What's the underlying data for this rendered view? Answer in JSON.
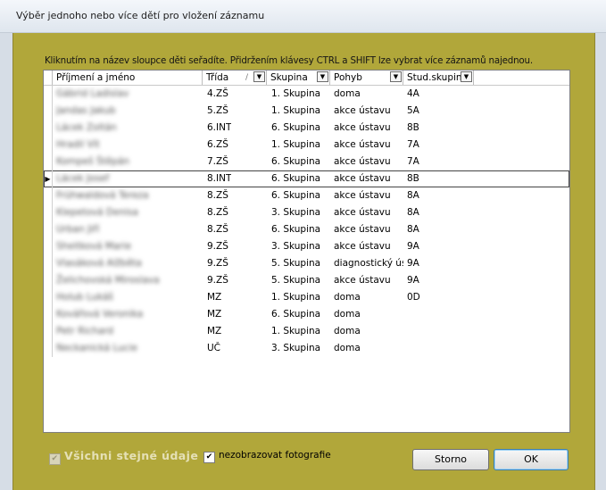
{
  "window": {
    "title": "Výběr jednoho nebo více dětí pro vložení záznamu"
  },
  "hint": "Kliknutím na název sloupce děti seřadíte. Přidržením klávesy CTRL a SHIFT lze vybrat více záznamů najednou.",
  "columns": {
    "name": "Příjmení a jméno",
    "trida": "Třída",
    "sort_indicator": "/",
    "skupina": "Skupina",
    "pohyb": "Pohyb",
    "stud": "Stud.skupina",
    "dropdown_glyph": "▼"
  },
  "current_row_marker": "▶",
  "rows": [
    {
      "name": "Gábrid Ladislav",
      "trida": "4.ZŠ",
      "skupina": "1. Skupina",
      "pohyb": "doma",
      "stud": "4A"
    },
    {
      "name": "Jandas Jakub",
      "trida": "5.ZŠ",
      "skupina": "1. Skupina",
      "pohyb": "akce ústavu",
      "stud": "5A"
    },
    {
      "name": "Lácek Zoltán",
      "trida": "6.INT",
      "skupina": "6. Skupina",
      "pohyb": "akce ústavu",
      "stud": "8B"
    },
    {
      "name": "Hradil Vít",
      "trida": "6.ZŠ",
      "skupina": "1. Skupina",
      "pohyb": "akce ústavu",
      "stud": "7A"
    },
    {
      "name": "Kompeš Štěpán",
      "trida": "7.ZŠ",
      "skupina": "6. Skupina",
      "pohyb": "akce ústavu",
      "stud": "7A"
    },
    {
      "name": "Lácek Josef",
      "trida": "8.INT",
      "skupina": "6. Skupina",
      "pohyb": "akce ústavu",
      "stud": "8B"
    },
    {
      "name": "Frühwaldová Tereza",
      "trida": "8.ZŠ",
      "skupina": "6. Skupina",
      "pohyb": "akce ústavu",
      "stud": "8A"
    },
    {
      "name": "Klepetová Denisa",
      "trida": "8.ZŠ",
      "skupina": "3. Skupina",
      "pohyb": "akce ústavu",
      "stud": "8A"
    },
    {
      "name": "Urban Jiří",
      "trida": "8.ZŠ",
      "skupina": "6. Skupina",
      "pohyb": "akce ústavu",
      "stud": "8A"
    },
    {
      "name": "Sheitková Marie",
      "trida": "9.ZŠ",
      "skupina": "3. Skupina",
      "pohyb": "akce ústavu",
      "stud": "9A"
    },
    {
      "name": "Vlasáková Alžběta",
      "trida": "9.ZŠ",
      "skupina": "5. Skupina",
      "pohyb": "diagnostický ústa",
      "stud": "9A"
    },
    {
      "name": "Želichovská Miroslava",
      "trida": "9.ZŠ",
      "skupina": "5. Skupina",
      "pohyb": "akce ústavu",
      "stud": "9A"
    },
    {
      "name": "Holub Lukáš",
      "trida": "MZ",
      "skupina": "1. Skupina",
      "pohyb": "doma",
      "stud": "0D"
    },
    {
      "name": "Kovářová Veronika",
      "trida": "MZ",
      "skupina": "6. Skupina",
      "pohyb": "doma",
      "stud": ""
    },
    {
      "name": "Petr Richard",
      "trida": "MZ",
      "skupina": "1. Skupina",
      "pohyb": "doma",
      "stud": ""
    },
    {
      "name": "Neckanická Lucie",
      "trida": "UČ",
      "skupina": "3. Skupina",
      "pohyb": "doma",
      "stud": ""
    }
  ],
  "footer": {
    "same_data_label": "Všichni stejné údaje",
    "same_data_checked": "✔",
    "nofoto_label": "nezobrazovat fotografie",
    "nofoto_checked": "✔",
    "cancel_label": "Storno",
    "ok_label": "OK"
  }
}
